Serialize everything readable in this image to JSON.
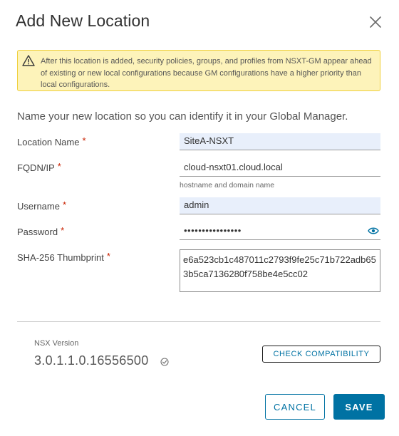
{
  "dialog": {
    "title": "Add New Location",
    "close_icon": "close-icon"
  },
  "warning": {
    "icon": "warning-icon",
    "text": "After this location is added, security policies, groups, and profiles from NSXT-GM appear ahead of existing or new local configurations because GM configurations have a higher priority than local configurations."
  },
  "form": {
    "intro": "Name your new location so you can identify it in your Global Manager.",
    "required_marker": "*",
    "location_name": {
      "label": "Location Name",
      "value": "SiteA-NSXT"
    },
    "fqdn": {
      "label": "FQDN/IP",
      "value": "cloud-nsxt01.cloud.local",
      "helper": "hostname and domain name"
    },
    "username": {
      "label": "Username",
      "value": "admin"
    },
    "password": {
      "label": "Password",
      "value": "••••••••••••••••",
      "toggle_icon": "eye-icon"
    },
    "thumbprint": {
      "label": "SHA-256 Thumbprint",
      "value": "e6a523cb1c487011c2793f9fe25c71b722adb653b5ca7136280f758be4e5cc02"
    }
  },
  "version": {
    "label": "NSX Version",
    "value": "3.0.1.1.0.16556500",
    "status_icon": "check-circle-icon"
  },
  "buttons": {
    "check_compat": "CHECK COMPATIBILITY",
    "cancel": "CANCEL",
    "save": "SAVE"
  },
  "colors": {
    "primary": "#0072a3",
    "warning_bg": "#fdf3ba",
    "warning_border": "#efcf3a",
    "required": "#c92100",
    "filled_input": "#e8effb"
  }
}
